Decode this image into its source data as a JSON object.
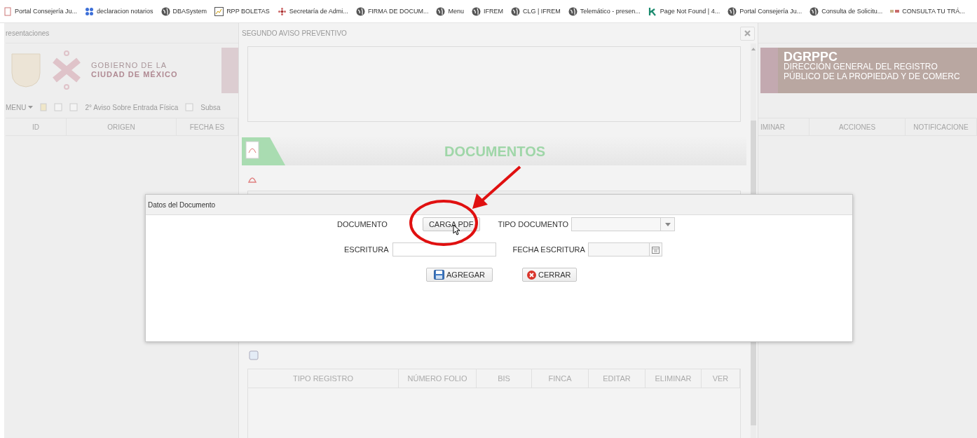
{
  "bookmarks": [
    {
      "label": "Portal Consejería Ju..."
    },
    {
      "label": "declaracion notarios"
    },
    {
      "label": "DBASystem"
    },
    {
      "label": "RPP BOLETAS"
    },
    {
      "label": "Secretaría de Admi..."
    },
    {
      "label": "FIRMA DE DOCUM..."
    },
    {
      "label": "Menu"
    },
    {
      "label": "IFREM"
    },
    {
      "label": "CLG | IFREM"
    },
    {
      "label": "Telemático - presen..."
    },
    {
      "label": "Page Not Found | 4..."
    },
    {
      "label": "Portal Consejería Ju..."
    },
    {
      "label": "Consulta de Solicitu..."
    },
    {
      "label": "CONSULTA TU TRÁ..."
    }
  ],
  "background_page": {
    "tab_title": "resentaciones",
    "logo_text": [
      "GOBIERNO DE LA",
      "CIUDAD DE MÉXICO"
    ],
    "banner": {
      "title": "DGRPPC",
      "subtitle": [
        "DIRECCIÓN GENERAL DEL REGISTRO",
        "PÚBLICO DE LA PROPIEDAD Y DE COMERC"
      ]
    },
    "toolbar": {
      "menu": "MENU",
      "items": [
        "2° Aviso Sobre Entrada Física",
        "Subsa"
      ]
    },
    "columns_left": [
      "ID",
      "ORIGEN",
      "FECHA ES"
    ],
    "columns_right": [
      "IMINAR",
      "ACCIONES",
      "NOTIFICACIONE"
    ]
  },
  "modal": {
    "title": "SEGUNDO AVISO PREVENTIVO",
    "section_title": "DOCUMENTOS",
    "records_table": {
      "columns": [
        "TIPO REGISTRO",
        "NÚMERO FOLIO",
        "BIS",
        "FINCA",
        "EDITAR",
        "ELIMINAR",
        "VER"
      ]
    }
  },
  "dialog": {
    "title": "Datos del Documento",
    "document": {
      "label": "DOCUMENTO",
      "button": "CARGA PDF"
    },
    "document_type": {
      "label": "TIPO DOCUMENTO"
    },
    "deed": {
      "label": "ESCRITURA"
    },
    "deed_date": {
      "label": "FECHA ESCRITURA"
    },
    "actions": [
      {
        "label": "AGREGAR",
        "kind": "save"
      },
      {
        "label": "CERRAR",
        "kind": "close"
      }
    ]
  }
}
